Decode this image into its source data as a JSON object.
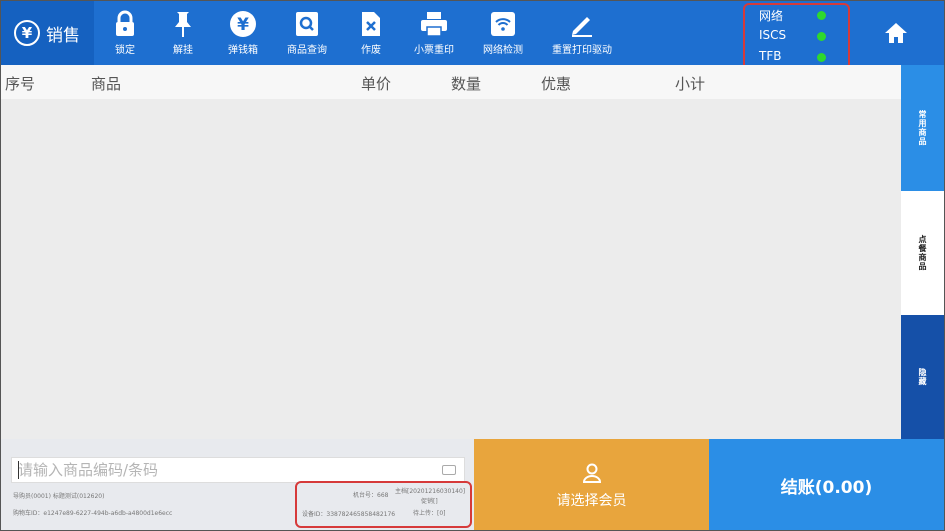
{
  "brand": {
    "symbol": "¥",
    "title": "销售"
  },
  "toolbar": [
    {
      "label": "锁定",
      "icon": "lock-icon"
    },
    {
      "label": "解挂",
      "icon": "pin-icon"
    },
    {
      "label": "弹钱箱",
      "icon": "cash-drawer-icon"
    },
    {
      "label": "商品查询",
      "icon": "product-search-icon"
    },
    {
      "label": "作废",
      "icon": "void-document-icon"
    },
    {
      "label": "小票重印",
      "icon": "printer-icon"
    },
    {
      "label": "网络检测",
      "icon": "wifi-icon"
    },
    {
      "label": "重置打印驱动",
      "icon": "pencil-icon"
    }
  ],
  "status": [
    {
      "label": "网络",
      "state_color": "#2ed82e"
    },
    {
      "label": "ISCS",
      "state_color": "#2ed82e"
    },
    {
      "label": "TFB",
      "state_color": "#2ed82e"
    }
  ],
  "table": {
    "headers": {
      "index": "序号",
      "product": "商品",
      "unit_price": "单价",
      "quantity": "数量",
      "discount": "优惠",
      "subtotal": "小计"
    }
  },
  "side_tabs": [
    "常用商品",
    "点餐商品",
    "隐藏"
  ],
  "search": {
    "placeholder": "请输入商品编码/条码"
  },
  "footer_info": {
    "cashier": "导购员(0001) 标题测试(012620)",
    "shopping_cart_id": "购物车ID：e1247e89-6227-494b-a6db-a4800d1e6ecc",
    "terminal_no": "机台号：668",
    "main_version": "主档[20201216030140]",
    "version_status": "促销[]",
    "device_id": "设备ID：338782465858482176",
    "pending_upload": "待上传：[0]"
  },
  "member_button": {
    "label": "请选择会员",
    "icon": "user-icon"
  },
  "checkout_button": {
    "label": "结账(0.00)"
  },
  "colors": {
    "primary": "#1e6fd0",
    "accent_orange": "#e8a53d",
    "accent_blue": "#2b8ee6",
    "highlight": "#d63a3a"
  }
}
